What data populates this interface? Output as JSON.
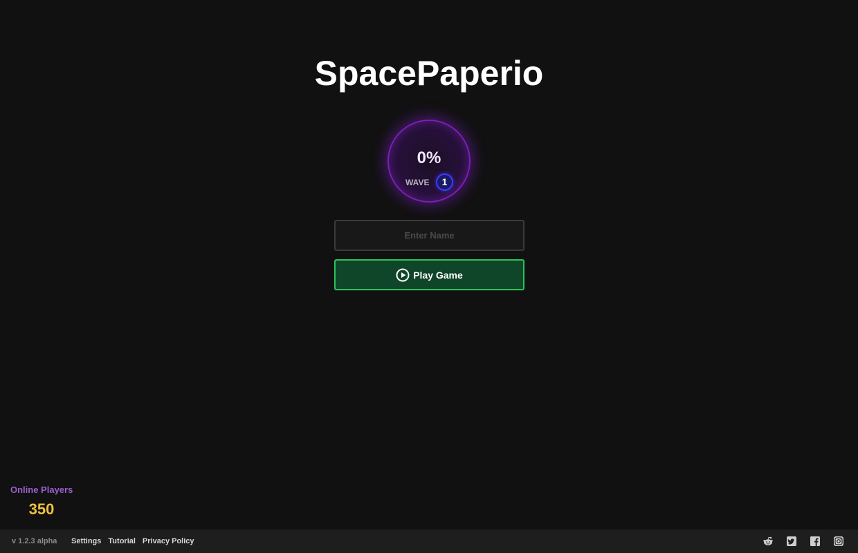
{
  "title": "SpacePaperio",
  "loader": {
    "percent": "0%",
    "wave_label": "WAVE",
    "wave_number": "1",
    "progress_fraction": 0
  },
  "name_input": {
    "value": "",
    "placeholder": "Enter Name"
  },
  "play_button": {
    "label": "Play Game",
    "icon": "play-icon"
  },
  "online": {
    "label": "Online Players",
    "count": "350"
  },
  "footer": {
    "version": "v 1.2.3 alpha",
    "links": [
      "Settings",
      "Tutorial",
      "Privacy Policy"
    ],
    "social_icons": [
      "reddit-icon",
      "twitter-icon",
      "facebook-icon",
      "instagram-icon"
    ]
  },
  "colors": {
    "background": "#111111",
    "ring": "#7a1fb8",
    "play_border": "#25c55a",
    "play_fill": "#0f4528",
    "online_label": "#9a5fd1",
    "online_count": "#f0c23c",
    "footer_bg": "#1e1e1e"
  }
}
